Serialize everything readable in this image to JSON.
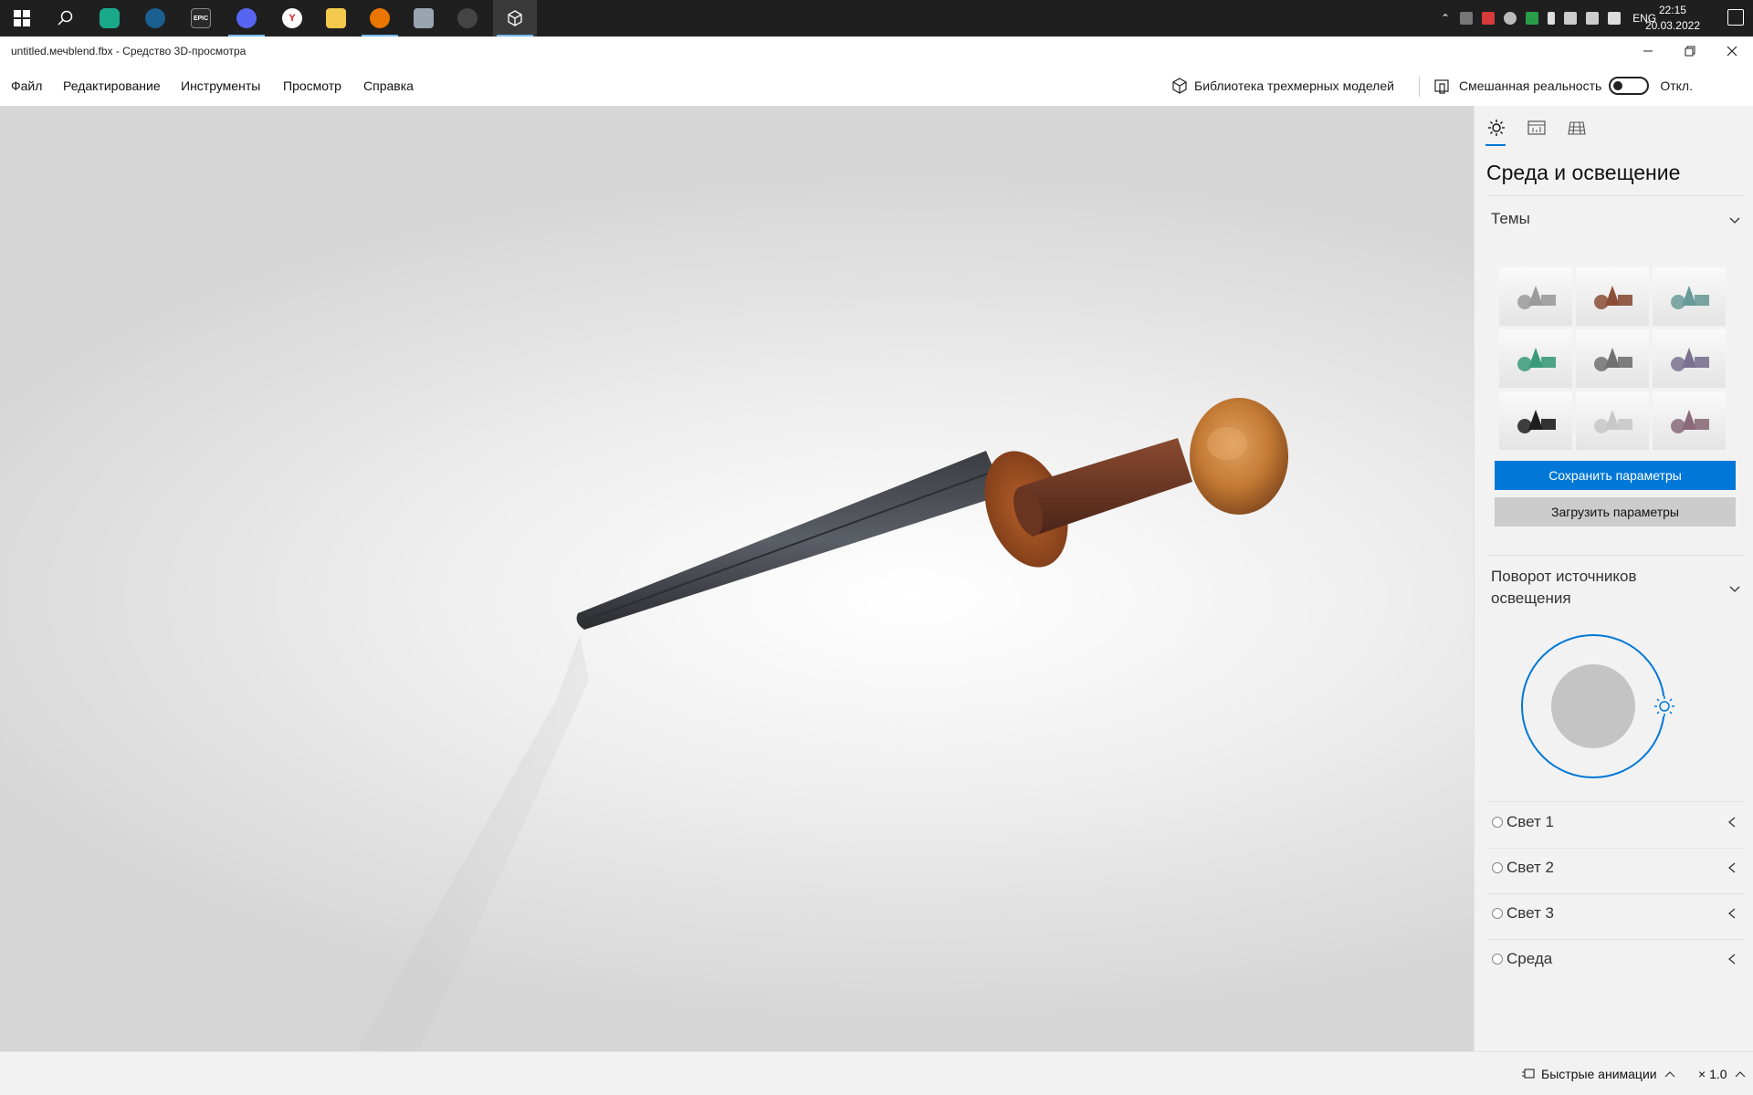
{
  "taskbar": {
    "icons": [
      "windows-start",
      "search",
      "app-hex",
      "steam",
      "epic-games",
      "discord",
      "yandex-browser",
      "file-explorer",
      "blender",
      "photos",
      "settings-app",
      "3d-viewer"
    ],
    "tray": {
      "language": "ENG"
    },
    "clock": {
      "time": "22:15",
      "date": "20.03.2022"
    }
  },
  "window": {
    "title": "untitled.мечblend.fbx - Средство 3D-просмотра"
  },
  "menu": {
    "file": "Файл",
    "edit": "Редактирование",
    "tools": "Инструменты",
    "view": "Просмотр",
    "help": "Справка",
    "library": "Библиотека трехмерных моделей",
    "mixed_reality": "Смешанная реальность",
    "mr_state": "Откл."
  },
  "panel": {
    "title": "Среда и освещение",
    "themes_label": "Темы",
    "save_button": "Сохранить параметры",
    "load_button": "Загрузить параметры",
    "rotation_label_line1": "Поворот источников",
    "rotation_label_line2": "освещения",
    "lights": [
      {
        "label": "Свет 1"
      },
      {
        "label": "Свет 2"
      },
      {
        "label": "Свет 3"
      },
      {
        "label": "Среда"
      }
    ],
    "themes": [
      {
        "name": "theme-neutral",
        "obj": "#9a9a9a"
      },
      {
        "name": "theme-warm",
        "obj": "#8a4e36"
      },
      {
        "name": "theme-teal",
        "obj": "#6a9a98"
      },
      {
        "name": "theme-green",
        "obj": "#3a9a7a"
      },
      {
        "name": "theme-gray",
        "obj": "#707070"
      },
      {
        "name": "theme-purple",
        "obj": "#7a7290"
      },
      {
        "name": "theme-dark",
        "obj": "#1e1e1e"
      },
      {
        "name": "theme-light",
        "obj": "#c8c8c8"
      },
      {
        "name": "theme-sunset",
        "obj": "#8a6a7a"
      }
    ]
  },
  "status": {
    "animations": "Быстрые анимации",
    "speed": "× 1.0"
  },
  "colors": {
    "accent": "#0078d7",
    "taskbar": "#1f1f1f"
  }
}
